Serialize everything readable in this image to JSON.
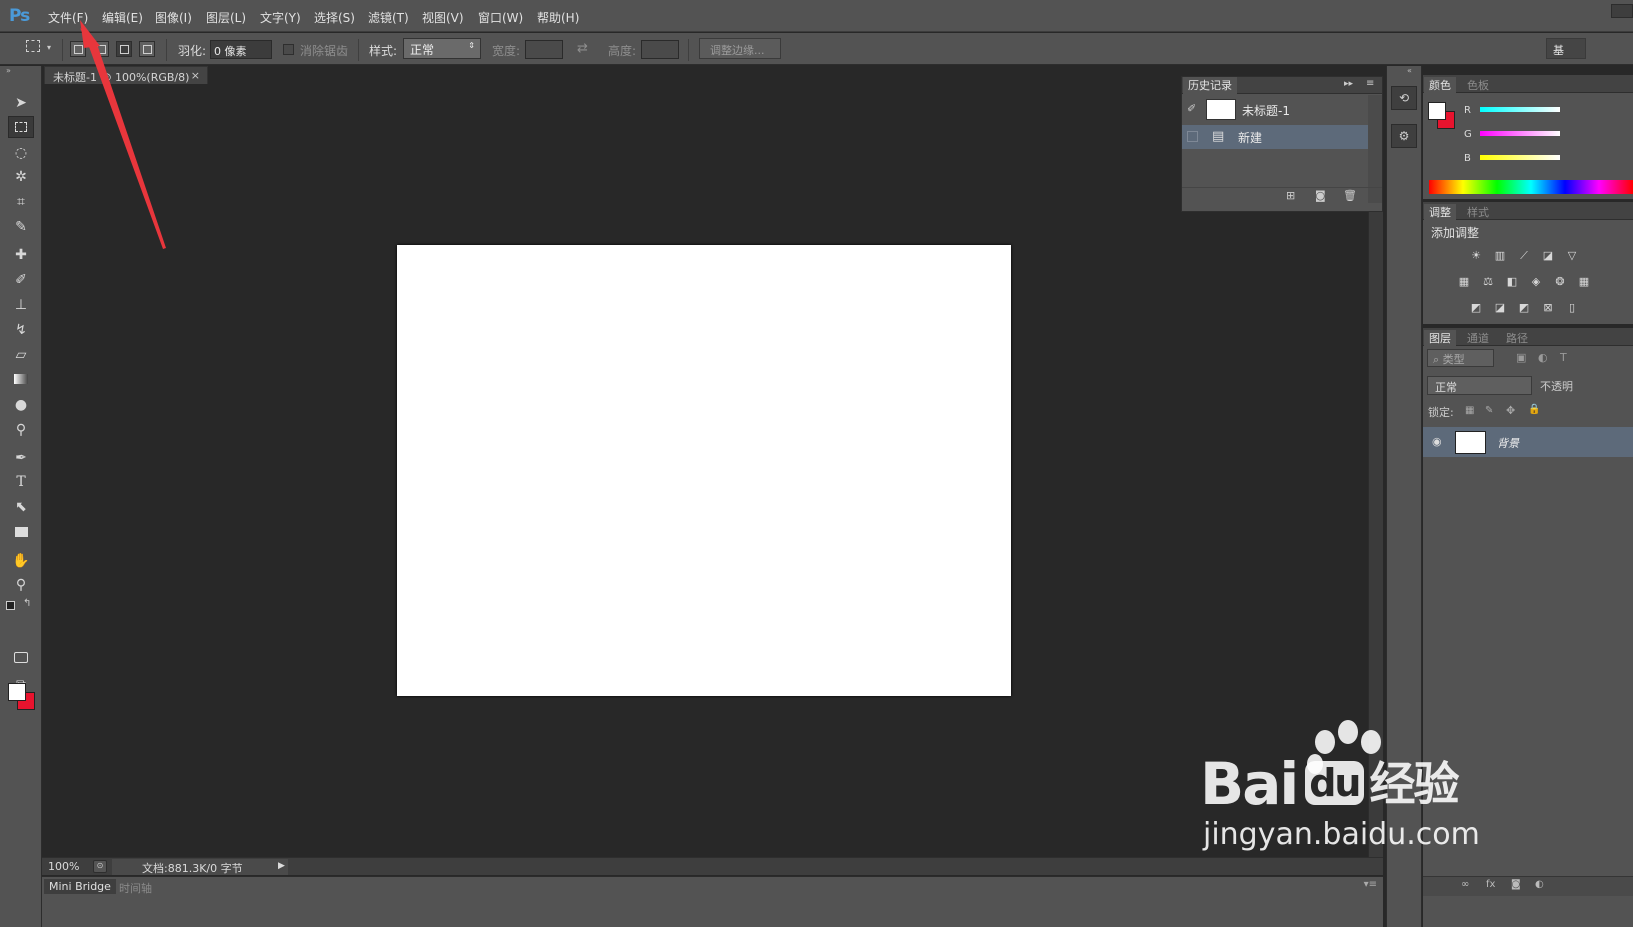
{
  "menu": {
    "logo": "Ps",
    "items": [
      "文件(F)",
      "编辑(E)",
      "图像(I)",
      "图层(L)",
      "文字(Y)",
      "选择(S)",
      "滤镜(T)",
      "视图(V)",
      "窗口(W)",
      "帮助(H)"
    ]
  },
  "options": {
    "feather_label": "羽化:",
    "feather_value": "0 像素",
    "antialias_label": "消除锯齿",
    "style_label": "样式:",
    "style_value": "正常",
    "width_label": "宽度:",
    "height_label": "高度:",
    "refine_edge_label": "调整边缘...",
    "workspace_label": "基"
  },
  "document": {
    "tab_title": "未标题-1 @ 100%(RGB/8)",
    "tab_close": "×",
    "zoom": "100%",
    "doc_info": "文档:881.3K/0 字节",
    "canvas_color": "#ffffff"
  },
  "bottom_tabs": [
    "Mini Bridge",
    "时间轴"
  ],
  "history": {
    "title": "历史记录",
    "snapshot_label": "未标题-1",
    "steps": [
      "新建"
    ]
  },
  "color_panel": {
    "tabs": [
      "颜色",
      "色板"
    ],
    "channels": [
      "R",
      "G",
      "B"
    ],
    "foreground": "#ffffff",
    "background": "#e8132e"
  },
  "adjustments_panel": {
    "tabs": [
      "调整",
      "样式"
    ],
    "heading": "添加调整"
  },
  "layers_panel": {
    "tabs": [
      "图层",
      "通道",
      "路径"
    ],
    "filter_label": "类型",
    "blend_mode": "正常",
    "opacity_label": "不透明",
    "lock_label": "锁定:",
    "layers": [
      "背景"
    ]
  },
  "watermark": {
    "brand": "Bai",
    "brand_suffix": "du",
    "product": "经验",
    "url": "jingyan.baidu.com"
  },
  "colors": {
    "panel_bg": "#535353",
    "workspace_bg": "#282828",
    "selection": "#5d6a7a",
    "annotation_arrow": "#e8363c"
  }
}
